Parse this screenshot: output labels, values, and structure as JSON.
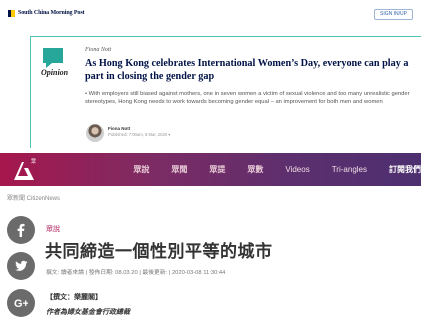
{
  "scmp": {
    "logo_text": "South China Morning Post",
    "signin_label": "SIGN IN/UP"
  },
  "opinion_card": {
    "label": "Opinion",
    "author": "Fiona Nott",
    "headline": "As Hong Kong celebrates International Women’s Day, everyone can play a part in closing the gender gap",
    "summary": "• With employers still biased against mothers, one in seven women a victim of sexual violence and too many unrealistic gender stereotypes, Hong Kong needs to work towards becoming gender equal – an improvement for both men and women",
    "byline_name": "Fiona Nott",
    "published": "Published: 7:00am, 8 Mar, 2020 ▾",
    "accent_color": "#27a79a"
  },
  "citizen_news": {
    "logo_text": "眾",
    "nav": [
      "眾說",
      "眾聞",
      "眾提",
      "眾數",
      "Videos",
      "Tri-angles",
      "訂閱我們"
    ],
    "breadcrumb": "眾新聞 CitizenNews",
    "brand_color": "#a6174d"
  },
  "share_buttons": [
    "facebook-icon",
    "twitter-icon",
    "google-plus-icon"
  ],
  "article": {
    "category": "眾說",
    "title": "共同締造一個性別平等的城市",
    "meta": "撰文: 讀者來論 | 發佈日期: 08.03.20 | 最後更新: | 2020-03-08 11:30:44",
    "author_line": "【撰文：樂麗閣】",
    "author_role": "作者為婦女基金會行政總裁"
  }
}
